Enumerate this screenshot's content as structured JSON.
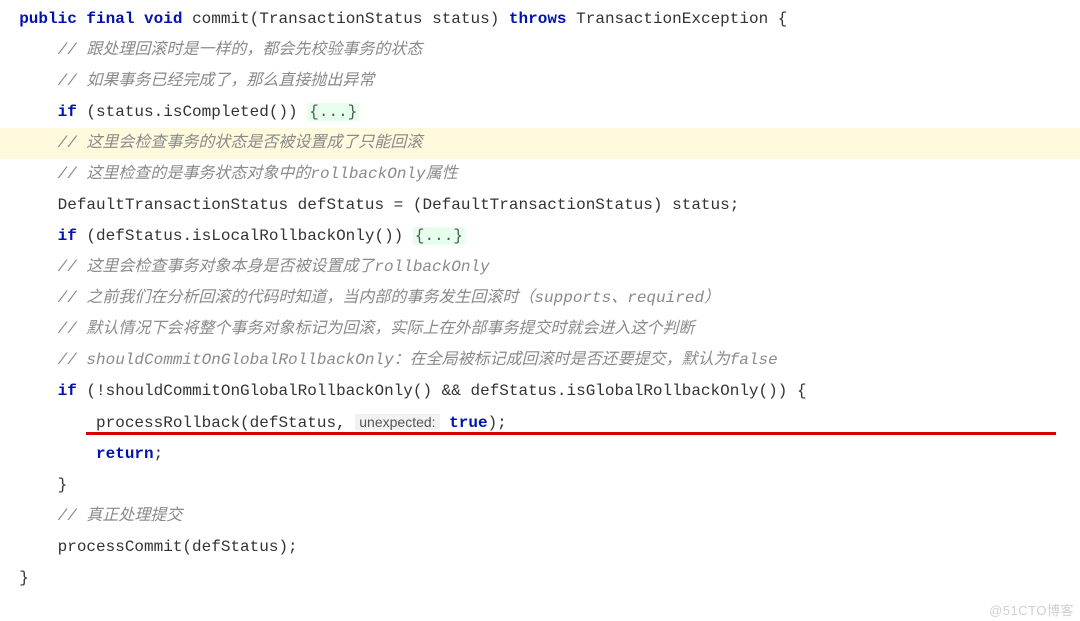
{
  "code": {
    "sig_public": "public",
    "sig_final": "final",
    "sig_void": "void",
    "sig_name": "commit(TransactionStatus status)",
    "sig_throws": "throws",
    "sig_exc": "TransactionException {",
    "c1": "// 跟处理回滚时是一样的，都会先校验事务的状态",
    "c2": "// 如果事务已经完成了，那么直接抛出异常",
    "if1_kw": "if",
    "if1_cond": "(status.isCompleted())",
    "fold1": "{...}",
    "c3": "// 这里会检查事务的状态是否被设置成了只能回滚",
    "c4": "// 这里检查的是事务状态对象中的rollbackOnly属性",
    "decl": "DefaultTransactionStatus defStatus = (DefaultTransactionStatus) status;",
    "if2_kw": "if",
    "if2_cond": "(defStatus.isLocalRollbackOnly())",
    "fold2": "{...}",
    "c5": "// 这里会检查事务对象本身是否被设置成了rollbackOnly",
    "c6": "// 之前我们在分析回滚的代码时知道，当内部的事务发生回滚时（supports、required）",
    "c7": "// 默认情况下会将整个事务对象标记为回滚，实际上在外部事务提交时就会进入这个判断",
    "c8": "// shouldCommitOnGlobalRollbackOnly：在全局被标记成回滚时是否还要提交，默认为false",
    "if3_kw": "if",
    "if3_cond": "(!shouldCommitOnGlobalRollbackOnly() && defStatus.isGlobalRollbackOnly()) {",
    "pr_call": "processRollback(defStatus,",
    "pr_hint": "unexpected:",
    "pr_true": "true",
    "pr_end": ");",
    "ret_kw": "return",
    "ret_end": ";",
    "brace_close1": "}",
    "c9": "// 真正处理提交",
    "pc": "processCommit(defStatus);",
    "brace_close2": "}"
  },
  "watermark": "@51CTO博客"
}
